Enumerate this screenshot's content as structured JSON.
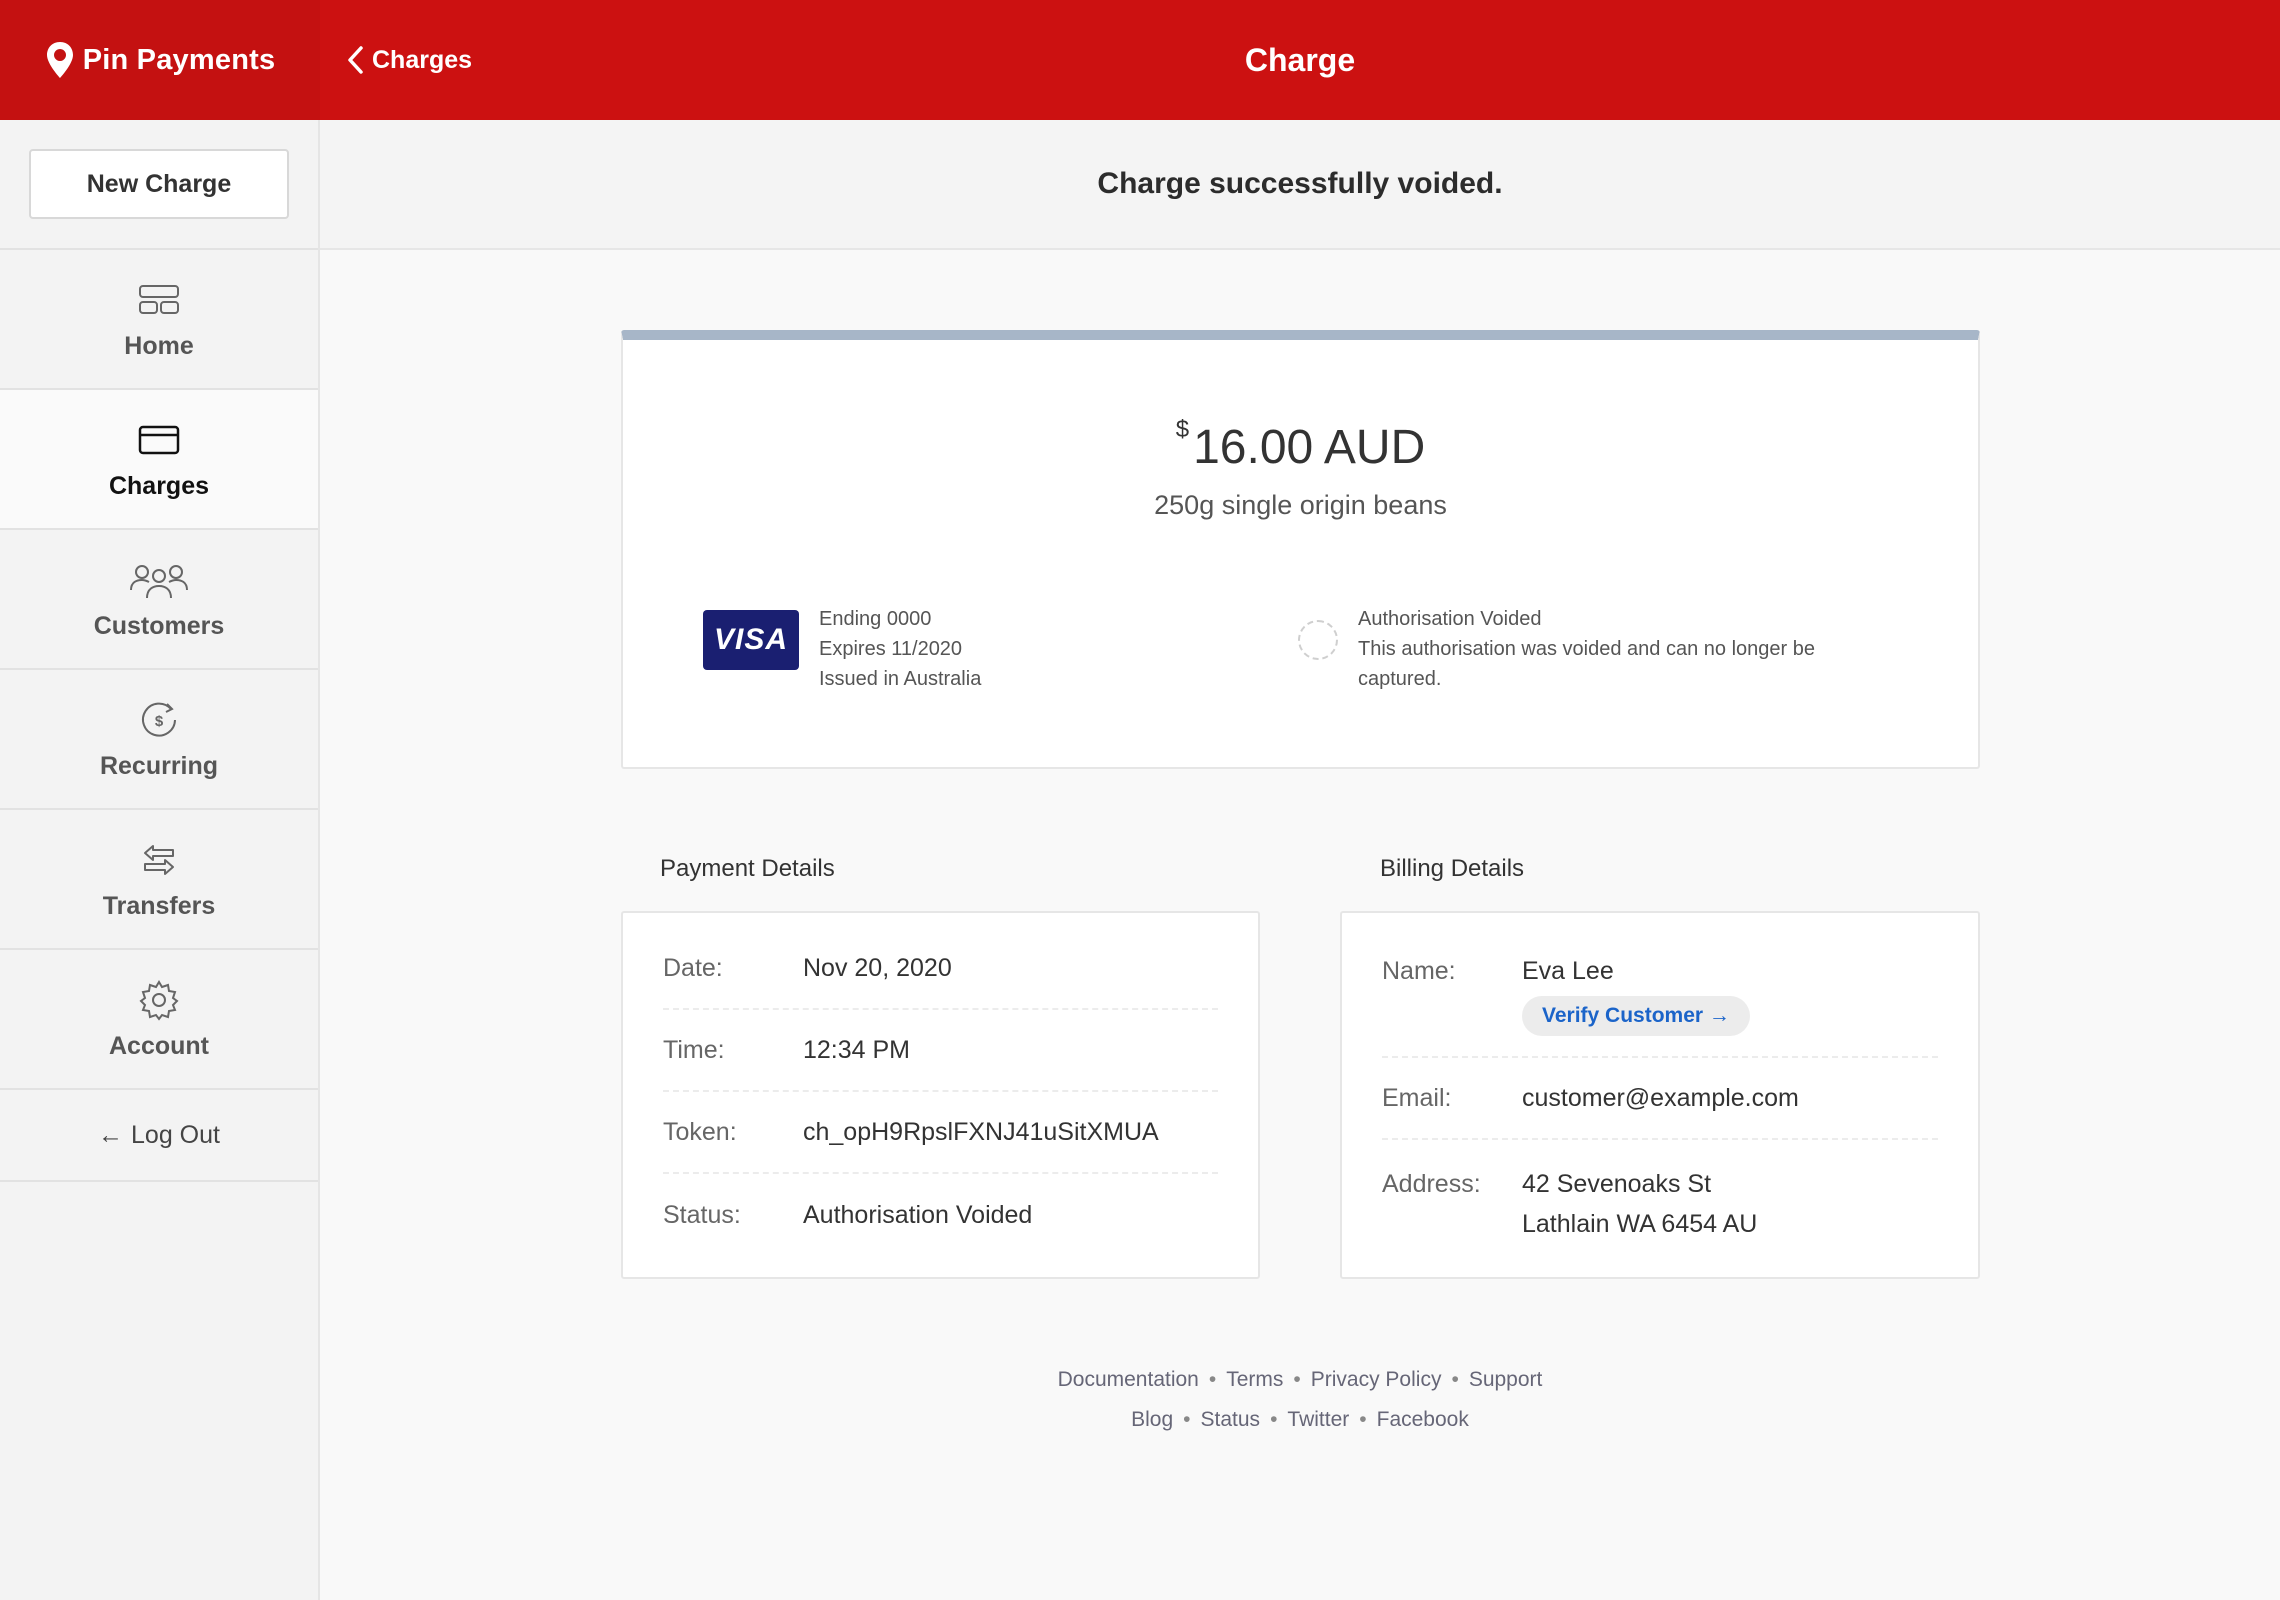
{
  "brand": {
    "name": "Pin Payments"
  },
  "header": {
    "back_label": "Charges",
    "title": "Charge"
  },
  "sidebar": {
    "new_charge": "New Charge",
    "items": [
      {
        "label": "Home",
        "icon": "home-icon"
      },
      {
        "label": "Charges",
        "icon": "card-icon"
      },
      {
        "label": "Customers",
        "icon": "customers-icon"
      },
      {
        "label": "Recurring",
        "icon": "recurring-icon"
      },
      {
        "label": "Transfers",
        "icon": "transfers-icon"
      },
      {
        "label": "Account",
        "icon": "gear-icon"
      }
    ],
    "logout": "Log Out"
  },
  "notice": "Charge successfully voided.",
  "charge": {
    "currency_symbol": "$",
    "amount": "16.00 AUD",
    "description": "250g single origin beans",
    "card_brand": "VISA",
    "card_lines": [
      "Ending 0000",
      "Expires 11/2020",
      "Issued in Australia"
    ],
    "status_title": "Authorisation Voided",
    "status_message": "This authorisation was voided and can no longer be captured."
  },
  "payment_details": {
    "title": "Payment Details",
    "rows": [
      {
        "label": "Date:",
        "value": "Nov 20, 2020"
      },
      {
        "label": "Time:",
        "value": "12:34 PM"
      },
      {
        "label": "Token:",
        "value": "ch_opH9RpslFXNJ41uSitXMUA"
      },
      {
        "label": "Status:",
        "value": "Authorisation Voided"
      }
    ]
  },
  "billing_details": {
    "title": "Billing Details",
    "name_label": "Name:",
    "name": "Eva Lee",
    "verify_label": "Verify Customer →",
    "email_label": "Email:",
    "email": "customer@example.com",
    "address_label": "Address:",
    "address_line1": "42 Sevenoaks St",
    "address_line2": "Lathlain WA 6454 AU"
  },
  "footer": {
    "row1": [
      "Documentation",
      "Terms",
      "Privacy Policy",
      "Support"
    ],
    "row2": [
      "Blog",
      "Status",
      "Twitter",
      "Facebook"
    ]
  },
  "colors": {
    "brand_red": "#cc1111",
    "link_blue": "#1b64c9",
    "visa_navy": "#1a1f71"
  }
}
